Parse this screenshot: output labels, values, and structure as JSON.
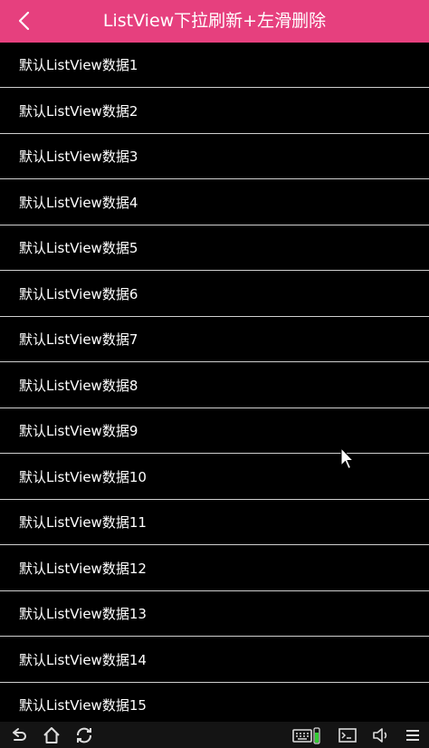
{
  "header": {
    "back_icon": "chevron-left-icon",
    "title": "ListView下拉刷新+左滑删除",
    "background": "#e6407e"
  },
  "list": {
    "items": [
      {
        "label": "默认ListView数据1"
      },
      {
        "label": "默认ListView数据2"
      },
      {
        "label": "默认ListView数据3"
      },
      {
        "label": "默认ListView数据4"
      },
      {
        "label": "默认ListView数据5"
      },
      {
        "label": "默认ListView数据6"
      },
      {
        "label": "默认ListView数据7"
      },
      {
        "label": "默认ListView数据8"
      },
      {
        "label": "默认ListView数据9"
      },
      {
        "label": "默认ListView数据10"
      },
      {
        "label": "默认ListView数据11"
      },
      {
        "label": "默认ListView数据12"
      },
      {
        "label": "默认ListView数据13"
      },
      {
        "label": "默认ListView数据14"
      },
      {
        "label": "默认ListView数据15"
      }
    ]
  },
  "navbar": {
    "left_icons": [
      "back-icon",
      "home-icon",
      "recent-apps-icon"
    ],
    "right_icons": [
      "keyboard-icon",
      "battery-icon",
      "terminal-icon",
      "volume-icon",
      "menu-icon"
    ]
  }
}
